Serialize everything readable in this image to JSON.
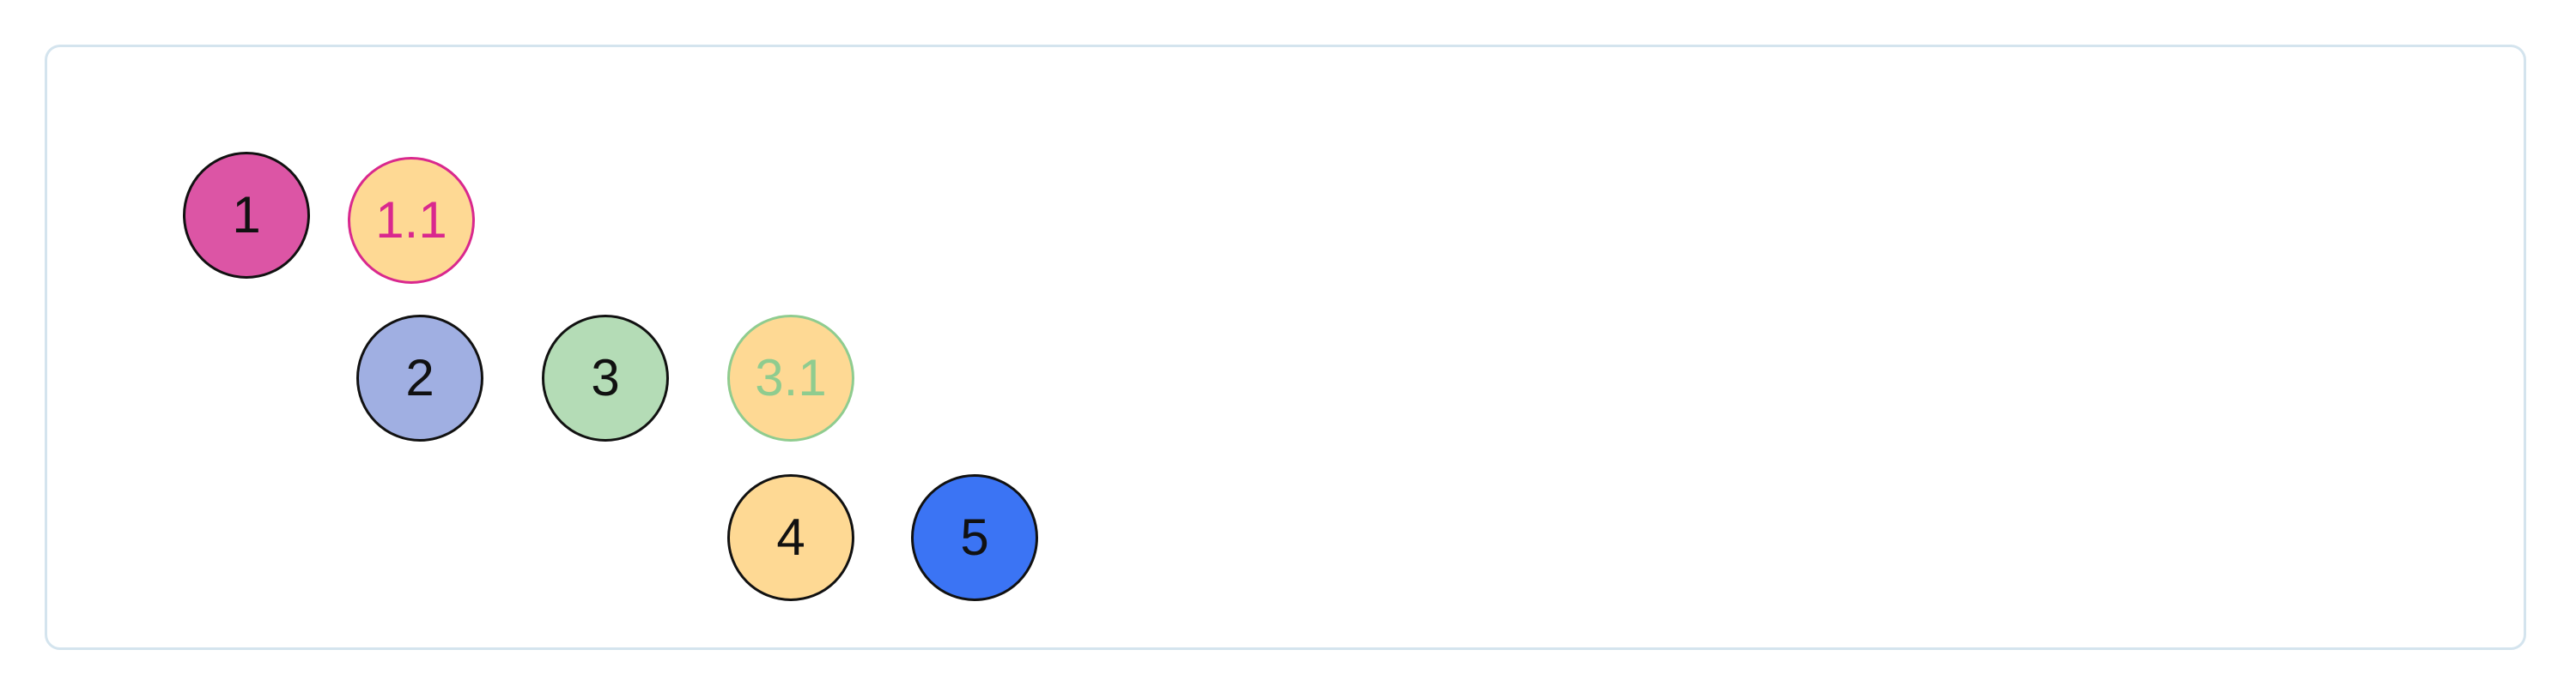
{
  "diagram": {
    "nodes": [
      {
        "id": "1",
        "label": "1",
        "fill": "#dc55a5",
        "stroke": "#111111",
        "text_color": "#111111"
      },
      {
        "id": "1.1",
        "label": "1.1",
        "fill": "#fed994",
        "stroke": "#d9288e",
        "text_color": "#d9288e"
      },
      {
        "id": "2",
        "label": "2",
        "fill": "#a0afe2",
        "stroke": "#111111",
        "text_color": "#111111"
      },
      {
        "id": "3",
        "label": "3",
        "fill": "#b4dcb6",
        "stroke": "#111111",
        "text_color": "#111111"
      },
      {
        "id": "3.1",
        "label": "3.1",
        "fill": "#fed994",
        "stroke": "#8fcc8f",
        "text_color": "#8fcc8f"
      },
      {
        "id": "4",
        "label": "4",
        "fill": "#fed994",
        "stroke": "#111111",
        "text_color": "#111111"
      },
      {
        "id": "5",
        "label": "5",
        "fill": "#3b74f4",
        "stroke": "#111111",
        "text_color": "#111111"
      }
    ]
  }
}
